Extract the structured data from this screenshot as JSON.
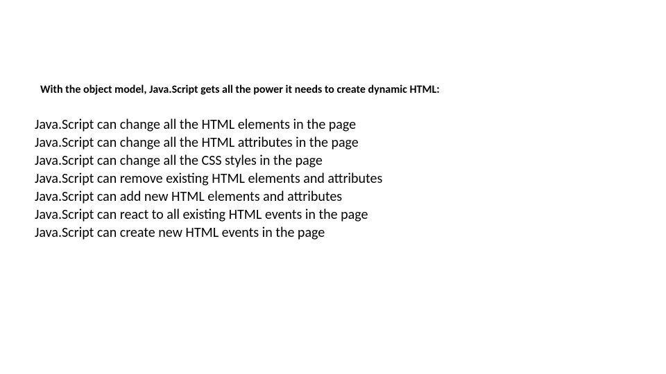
{
  "heading": "With the object model, Java.Script gets all the power it needs to create dynamic HTML:",
  "items": [
    "Java.Script can change all the HTML elements in the page",
    "Java.Script can change all the HTML attributes in the page",
    "Java.Script can change all the CSS styles in the page",
    "Java.Script can remove existing HTML elements and attributes",
    "Java.Script can add new HTML elements and attributes",
    "Java.Script can react to all existing HTML events in the page",
    "Java.Script can create new HTML events in the page"
  ]
}
